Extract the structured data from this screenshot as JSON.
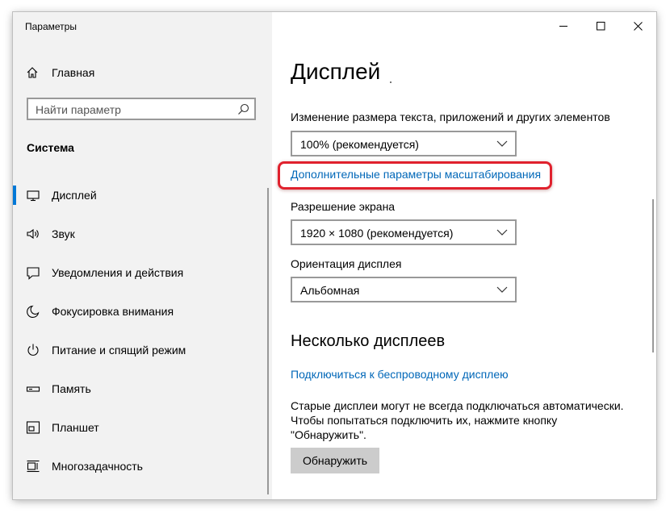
{
  "window": {
    "title": "Параметры",
    "controls": [
      "minimize-icon",
      "maximize-icon",
      "close-icon"
    ]
  },
  "sidebar": {
    "home_label": "Главная",
    "search_placeholder": "Найти параметр",
    "section_title": "Система",
    "items": [
      {
        "label": "Дисплей",
        "icon": "monitor-icon",
        "selected": true
      },
      {
        "label": "Звук",
        "icon": "speaker-icon",
        "selected": false
      },
      {
        "label": "Уведомления и действия",
        "icon": "notification-icon",
        "selected": false
      },
      {
        "label": "Фокусировка внимания",
        "icon": "moon-icon",
        "selected": false
      },
      {
        "label": "Питание и спящий режим",
        "icon": "power-icon",
        "selected": false
      },
      {
        "label": "Память",
        "icon": "storage-icon",
        "selected": false
      },
      {
        "label": "Планшет",
        "icon": "tablet-icon",
        "selected": false
      },
      {
        "label": "Многозадачность",
        "icon": "multitasking-icon",
        "selected": false
      }
    ]
  },
  "main": {
    "page_title": "Дисплей",
    "scale_label": "Изменение размера текста, приложений и других элементов",
    "scale_value": "100% (рекомендуется)",
    "advanced_scaling_link": "Дополнительные параметры масштабирования",
    "resolution_label": "Разрешение экрана",
    "resolution_value": "1920 × 1080 (рекомендуется)",
    "orientation_label": "Ориентация дисплея",
    "orientation_value": "Альбомная",
    "multiple_displays_title": "Несколько дисплеев",
    "wireless_link": "Подключиться к беспроводному дисплею",
    "detect_text_lines": [
      "Старые дисплеи могут не всегда подключаться автоматически.",
      "Чтобы попытаться подключить их, нажмите кнопку",
      "\"Обнаружить\"."
    ],
    "detect_button": "Обнаружить"
  },
  "colors": {
    "accent": "#0078d7",
    "link": "#0067b8",
    "highlight": "#e0212d",
    "nav_background": "#f2f2f2"
  }
}
